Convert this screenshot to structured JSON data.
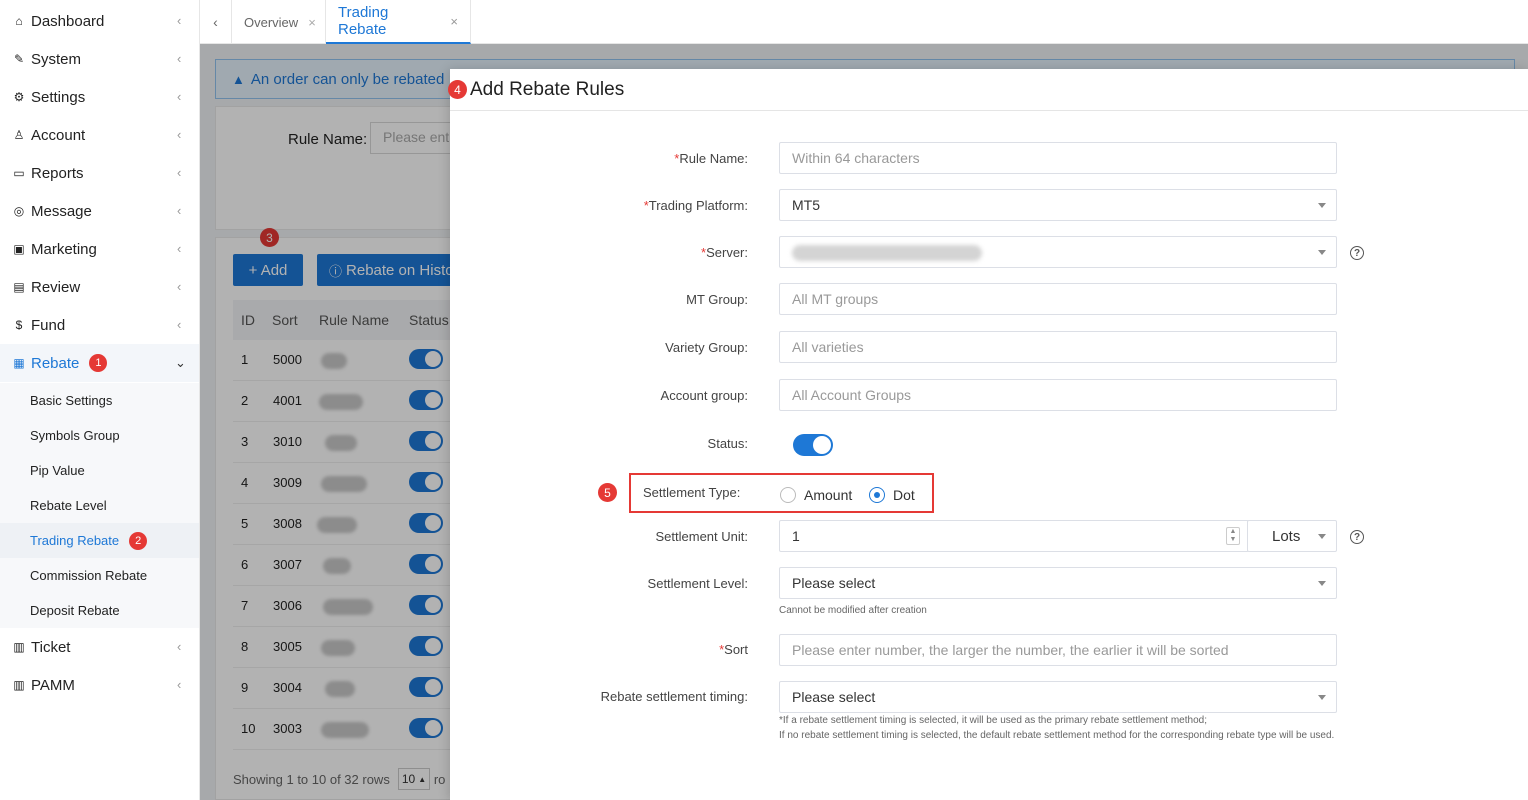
{
  "sidebar": {
    "items": [
      {
        "label": "Dashboard",
        "icon": "home-icon"
      },
      {
        "label": "System",
        "icon": "wrench-icon"
      },
      {
        "label": "Settings",
        "icon": "gear-icon"
      },
      {
        "label": "Account",
        "icon": "users-icon"
      },
      {
        "label": "Reports",
        "icon": "monitor-icon"
      },
      {
        "label": "Message",
        "icon": "chat-icon"
      },
      {
        "label": "Marketing",
        "icon": "gift-icon"
      },
      {
        "label": "Review",
        "icon": "clipboard-icon"
      },
      {
        "label": "Fund",
        "icon": "coin-icon"
      },
      {
        "label": "Rebate",
        "icon": "calendar-icon",
        "badge": "1"
      },
      {
        "label": "Ticket",
        "icon": "document-icon"
      },
      {
        "label": "PAMM",
        "icon": "document-icon"
      }
    ],
    "rebate_sub": [
      {
        "label": "Basic Settings"
      },
      {
        "label": "Symbols Group"
      },
      {
        "label": "Pip Value"
      },
      {
        "label": "Rebate Level"
      },
      {
        "label": "Trading Rebate",
        "badge": "2"
      },
      {
        "label": "Commission Rebate"
      },
      {
        "label": "Deposit Rebate"
      }
    ]
  },
  "tabs": [
    {
      "label": "Overview"
    },
    {
      "label": "Trading Rebate"
    }
  ],
  "background": {
    "alert": "An order can only be rebated",
    "rule_name_label": "Rule Name:",
    "rule_name_placeholder": "Please ent",
    "add_button": "+ Add",
    "add_badge": "3",
    "history_button": "Rebate on Histo",
    "columns": [
      "ID",
      "Sort",
      "Rule Name",
      "Status"
    ],
    "rows": [
      {
        "id": "1",
        "sort": "5000"
      },
      {
        "id": "2",
        "sort": "4001"
      },
      {
        "id": "3",
        "sort": "3010"
      },
      {
        "id": "4",
        "sort": "3009"
      },
      {
        "id": "5",
        "sort": "3008"
      },
      {
        "id": "6",
        "sort": "3007"
      },
      {
        "id": "7",
        "sort": "3006"
      },
      {
        "id": "8",
        "sort": "3005"
      },
      {
        "id": "9",
        "sort": "3004"
      },
      {
        "id": "10",
        "sort": "3003"
      }
    ],
    "footer": "Showing 1 to 10 of 32 rows",
    "page_size": "10",
    "footer_tail": "ro"
  },
  "modal": {
    "title": "Add Rebate Rules",
    "title_badge": "4",
    "rule_name": {
      "label": "Rule Name:",
      "placeholder": "Within 64 characters"
    },
    "trading_platform": {
      "label": "Trading Platform:",
      "value": "MT5"
    },
    "server": {
      "label": "Server:"
    },
    "mt_group": {
      "label": "MT Group:",
      "placeholder": "All MT groups"
    },
    "variety_group": {
      "label": "Variety Group:",
      "placeholder": "All varieties"
    },
    "account_group": {
      "label": "Account group:",
      "placeholder": "All Account Groups"
    },
    "status": {
      "label": "Status:",
      "enabled": true
    },
    "settlement_type": {
      "label": "Settlement Type:",
      "badge": "5",
      "options": [
        "Amount",
        "Dot"
      ],
      "selected": "Dot"
    },
    "settlement_unit": {
      "label": "Settlement Unit:",
      "value": "1",
      "unit": "Lots"
    },
    "settlement_level": {
      "label": "Settlement Level:",
      "value": "Please select",
      "hint": "Cannot be modified after creation"
    },
    "sort": {
      "label": "Sort",
      "placeholder": "Please enter number, the larger the number, the earlier it will be sorted"
    },
    "timing": {
      "label": "Rebate settlement timing:",
      "value": "Please select",
      "hint1": "*If a rebate settlement timing is selected, it will be used as the primary rebate settlement method;",
      "hint2": "If no rebate settlement timing is selected, the default rebate settlement method for the corresponding rebate type will be used."
    }
  },
  "colors": {
    "accent": "#1e78d6",
    "badge": "#e53935"
  }
}
